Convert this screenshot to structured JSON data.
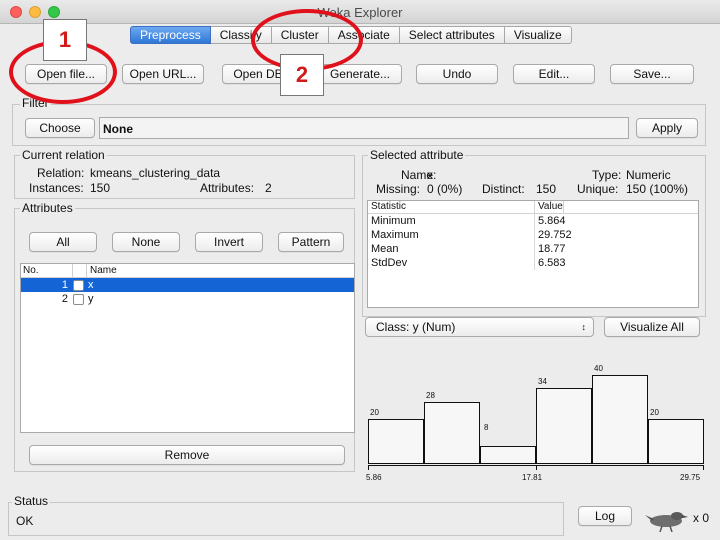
{
  "window": {
    "title": "Weka Explorer"
  },
  "tabs": [
    "Preprocess",
    "Classify",
    "Cluster",
    "Associate",
    "Select attributes",
    "Visualize"
  ],
  "toolbar": {
    "open_file": "Open file...",
    "open_url": "Open URL...",
    "open_db": "Open DB...",
    "generate": "Generate...",
    "undo": "Undo",
    "edit": "Edit...",
    "save": "Save..."
  },
  "filter": {
    "label": "Filter",
    "choose": "Choose",
    "value": "None",
    "apply": "Apply"
  },
  "current_relation": {
    "label": "Current relation",
    "relation_label": "Relation:",
    "relation": "kmeans_clustering_data",
    "instances_label": "Instances:",
    "instances": "150",
    "attributes_label": "Attributes:",
    "attributes": "2"
  },
  "attributes": {
    "label": "Attributes",
    "all": "All",
    "none": "None",
    "invert": "Invert",
    "pattern": "Pattern",
    "col_no": "No.",
    "col_name": "Name",
    "rows": [
      {
        "no": "1",
        "name": "x"
      },
      {
        "no": "2",
        "name": "y"
      }
    ],
    "remove": "Remove"
  },
  "selected_attribute": {
    "label": "Selected attribute",
    "name_label": "Name:",
    "name": "x",
    "type_label": "Type:",
    "type": "Numeric",
    "missing_label": "Missing:",
    "missing": "0 (0%)",
    "distinct_label": "Distinct:",
    "distinct": "150",
    "unique_label": "Unique:",
    "unique": "150 (100%)",
    "stats_header": [
      "Statistic",
      "Value"
    ],
    "stats": [
      {
        "stat": "Minimum",
        "value": "5.864"
      },
      {
        "stat": "Maximum",
        "value": "29.752"
      },
      {
        "stat": "Mean",
        "value": "18.77"
      },
      {
        "stat": "StdDev",
        "value": "6.583"
      }
    ]
  },
  "class_select": {
    "value": "Class: y (Num)"
  },
  "visualize_all": "Visualize All",
  "chart_data": {
    "type": "bar",
    "values": [
      20,
      28,
      8,
      34,
      40,
      20
    ],
    "value_labels": [
      "20",
      "28",
      "8",
      "34",
      "40",
      "20"
    ],
    "ylim": [
      0,
      40
    ],
    "x_tick_labels": [
      "5.86",
      "17.81",
      "29.75"
    ]
  },
  "status": {
    "label": "Status",
    "text": "OK",
    "log": "Log",
    "count": "x 0"
  },
  "annotations": {
    "one": "1",
    "two": "2",
    "color": "#e0111a"
  },
  "colors": {
    "selection": "#1464d6",
    "active_tab": "#2f77d6"
  }
}
